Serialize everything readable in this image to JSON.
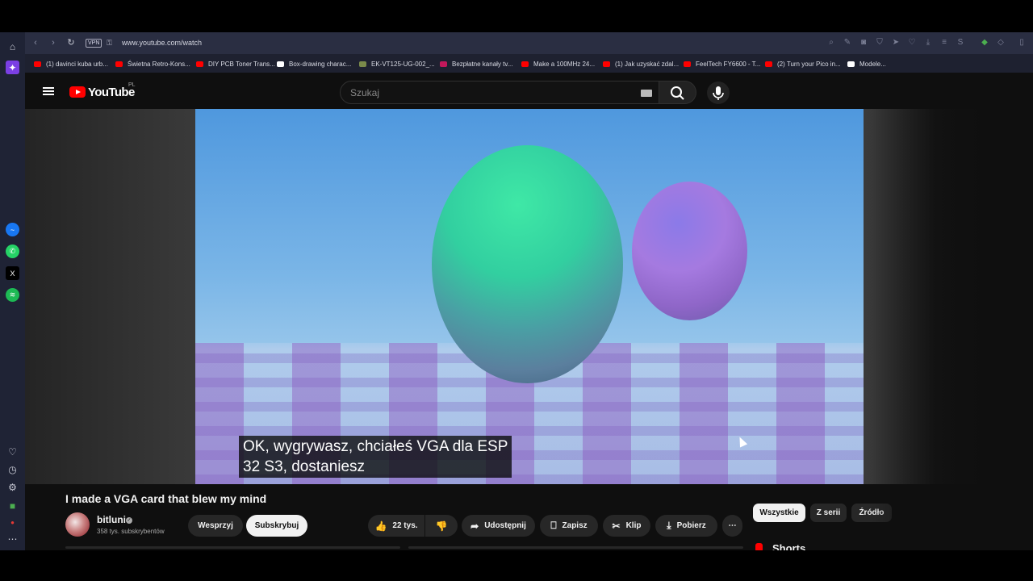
{
  "browser": {
    "url": "www.youtube.com/watch",
    "vpn_label": "VPN",
    "bookmarks": [
      {
        "label": "(1) davinci kuba urb...",
        "color": "#ff0000"
      },
      {
        "label": "Świetna Retro-Kons...",
        "color": "#ff0000"
      },
      {
        "label": "DIY PCB Toner Trans...",
        "color": "#ff0000"
      },
      {
        "label": "Box-drawing charac...",
        "color": "#ffffff"
      },
      {
        "label": "EK-VT125-UG-002_...",
        "color": "#7a8a4a"
      },
      {
        "label": "Bezpłatne kanały tv...",
        "color": "#c2185b"
      },
      {
        "label": "Make a 100MHz 24...",
        "color": "#ff0000"
      },
      {
        "label": "(1) Jak uzyskać zdal...",
        "color": "#ff0000"
      },
      {
        "label": "FeelTech FY6600 - T...",
        "color": "#ff0000"
      },
      {
        "label": "(2) Turn your Pico in...",
        "color": "#ff0000"
      },
      {
        "label": "Modele...",
        "color": "#ffffff"
      }
    ]
  },
  "sidebar_icons": [
    "home-icon",
    "aria-icon",
    "messenger-icon",
    "whatsapp-icon",
    "x-icon",
    "spotify-icon",
    "heart-icon",
    "history-icon",
    "settings-icon",
    "extensions-icon",
    "record-icon",
    "more-icon"
  ],
  "youtube": {
    "logo_text": "YouTube",
    "country_code": "PL",
    "search_placeholder": "Szukaj"
  },
  "video": {
    "subtitle_line1": "OK, wygrywasz, chciałeś VGA dla ESP",
    "subtitle_line2": "32 S3, dostaniesz",
    "title": "I made a VGA card that blew my mind"
  },
  "channel": {
    "name": "bitluni",
    "subscribers": "358 tys. subskrybentów",
    "support_label": "Wesprzyj",
    "subscribe_label": "Subskrybuj"
  },
  "actions": {
    "likes": "22 tys.",
    "share_label": "Udostępnij",
    "save_label": "Zapisz",
    "clip_label": "Klip",
    "download_label": "Pobierz"
  },
  "chips": [
    "Wszystkie",
    "Z serii",
    "Źródło"
  ],
  "shorts_label": "Shorts"
}
